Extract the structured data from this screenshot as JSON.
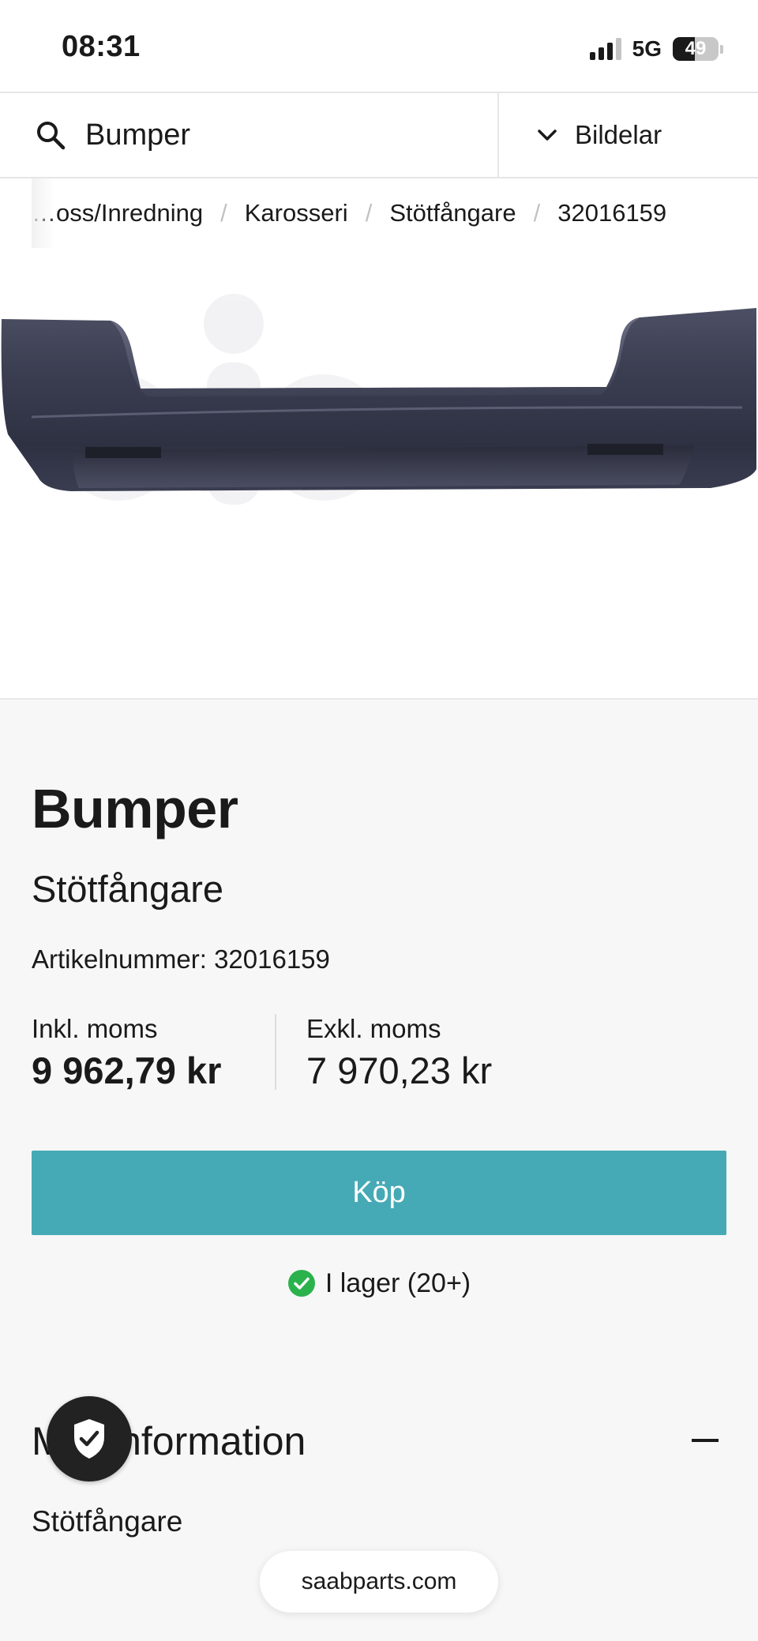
{
  "status_bar": {
    "time": "08:31",
    "network": "5G",
    "battery_percent": "49",
    "signal_bars_active": 3,
    "signal_bars_total": 4
  },
  "search": {
    "value": "Bumper",
    "icon": "search-icon"
  },
  "category": {
    "label": "Bildelar",
    "icon": "chevron-down-icon"
  },
  "breadcrumb": {
    "items": [
      "…oss/Inredning",
      "Karosseri",
      "Stötfångare",
      "32016159"
    ],
    "separator": "/"
  },
  "product": {
    "title": "Bumper",
    "subtitle": "Stötfångare",
    "article_label": "Artikelnummer:",
    "article_number": "32016159",
    "price_incl_label": "Inkl. moms",
    "price_incl_value": "9 962,79 kr",
    "price_excl_label": "Exkl. moms",
    "price_excl_value": "7 970,23 kr",
    "buy_label": "Köp",
    "stock_text": "I lager (20+)"
  },
  "more_info": {
    "title": "Mer information",
    "body": "Stötfångare",
    "icon": "minus-icon"
  },
  "privacy_badge": {
    "icon": "shield-check-icon"
  },
  "browser": {
    "url": "saabparts.com"
  },
  "colors": {
    "accent": "#45aab5",
    "stock_ok": "#2bb24c",
    "page_background": "#f7f7f7"
  }
}
